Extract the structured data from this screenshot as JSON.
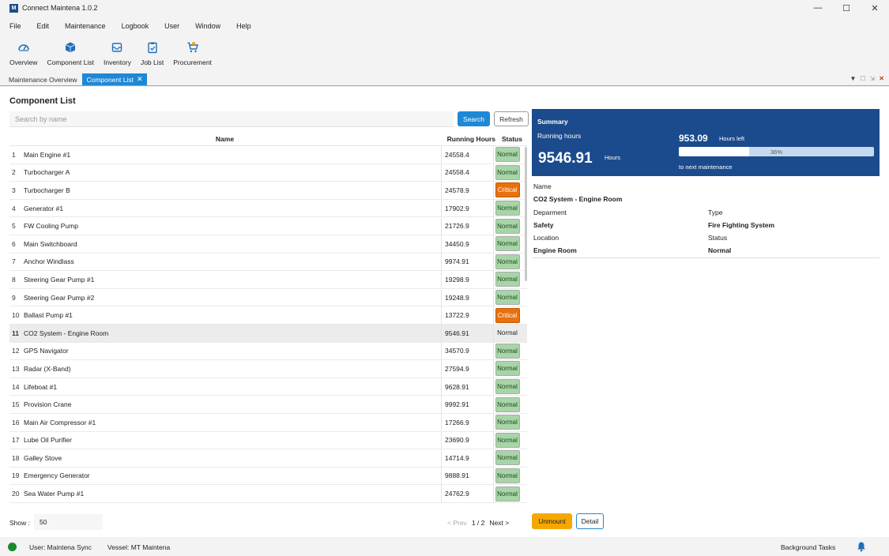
{
  "window": {
    "title": "Connect Maintena 1.0.2",
    "logo_letter": "M",
    "minimize": "—",
    "maximize": "☐",
    "close": "✕"
  },
  "menu": [
    "File",
    "Edit",
    "Maintenance",
    "Logbook",
    "User",
    "Window",
    "Help"
  ],
  "toolbar": [
    {
      "label": "Overview",
      "icon": "gauge-icon"
    },
    {
      "label": "Component List",
      "icon": "cube-icon"
    },
    {
      "label": "Inventory",
      "icon": "inbox-icon"
    },
    {
      "label": "Job List",
      "icon": "clipboard-icon"
    },
    {
      "label": "Procurement",
      "icon": "cart-icon"
    }
  ],
  "tabs": [
    {
      "label": "Maintenance Overview",
      "active": false
    },
    {
      "label": "Component List",
      "active": true,
      "close": "✕"
    }
  ],
  "tab_tools": {
    "menu": "▼",
    "max": "☐",
    "pin": "⇲",
    "close": "✕"
  },
  "page": {
    "title": "Component List",
    "search_placeholder": "Search by name",
    "search_label": "Search",
    "refresh_label": "Refresh"
  },
  "table": {
    "headers": {
      "name": "Name",
      "hours": "Running Hours",
      "status": "Status"
    },
    "rows": [
      {
        "num": "1",
        "name": "Main Engine #1",
        "hours": "24558.4",
        "status": "Normal"
      },
      {
        "num": "2",
        "name": "Turbocharger A",
        "hours": "24558.4",
        "status": "Normal"
      },
      {
        "num": "3",
        "name": "Turbocharger B",
        "hours": "24578.9",
        "status": "Critical"
      },
      {
        "num": "4",
        "name": "Generator #1",
        "hours": "17902.9",
        "status": "Normal"
      },
      {
        "num": "5",
        "name": "FW Cooling Pump",
        "hours": "21726.9",
        "status": "Normal"
      },
      {
        "num": "6",
        "name": "Main Switchboard",
        "hours": "34450.9",
        "status": "Normal"
      },
      {
        "num": "7",
        "name": "Anchor Windlass",
        "hours": "9974.91",
        "status": "Normal"
      },
      {
        "num": "8",
        "name": "Steering Gear Pump #1",
        "hours": "19298.9",
        "status": "Normal"
      },
      {
        "num": "9",
        "name": "Steering Gear Pump #2",
        "hours": "19248.9",
        "status": "Normal"
      },
      {
        "num": "10",
        "name": "Ballast Pump #1",
        "hours": "13722.9",
        "status": "Critical"
      },
      {
        "num": "11",
        "name": "CO2 System - Engine Room",
        "hours": "9546.91",
        "status": "Normal",
        "selected": true
      },
      {
        "num": "12",
        "name": "GPS Navigator",
        "hours": "34570.9",
        "status": "Normal"
      },
      {
        "num": "13",
        "name": "Radar (X-Band)",
        "hours": "27594.9",
        "status": "Normal"
      },
      {
        "num": "14",
        "name": "Lifeboat #1",
        "hours": "9628.91",
        "status": "Normal"
      },
      {
        "num": "15",
        "name": "Provision Crane",
        "hours": "9992.91",
        "status": "Normal"
      },
      {
        "num": "16",
        "name": "Main Air Compressor #1",
        "hours": "17266.9",
        "status": "Normal"
      },
      {
        "num": "17",
        "name": "Lube Oil Purifier",
        "hours": "23690.9",
        "status": "Normal"
      },
      {
        "num": "18",
        "name": "Galley Stove",
        "hours": "14714.9",
        "status": "Normal"
      },
      {
        "num": "19",
        "name": "Emergency Generator",
        "hours": "9888.91",
        "status": "Normal"
      },
      {
        "num": "20",
        "name": "Sea Water Pump #1",
        "hours": "24762.9",
        "status": "Normal"
      }
    ]
  },
  "summary": {
    "title": "Summary",
    "running_label": "Running hours",
    "running_value": "9546.91",
    "running_unit": "Hours",
    "left_value": "953.09",
    "left_unit": "Hours left",
    "progress_text": "36%",
    "progress_fraction": 0.36,
    "next_label": "to next maintenance"
  },
  "details": {
    "name_label": "Name",
    "name_value": "CO2 System - Engine Room",
    "department_label": "Deparment",
    "department_value": "Safety",
    "type_label": "Type",
    "type_value": "Fire Fighting System",
    "location_label": "Location",
    "location_value": "Engine Room",
    "status_label": "Status",
    "status_value": "Normal"
  },
  "footer": {
    "show_label": "Show :",
    "show_value": "50",
    "prev": "< Prev",
    "page": "1 / 2",
    "next": "Next >",
    "unmount_label": "Unmount",
    "detail_label": "Detail"
  },
  "statusbar": {
    "user": "User: Maintena Sync",
    "vessel": "Vessel: MT Maintena",
    "background_tasks": "Background Tasks"
  },
  "colors": {
    "primary": "#1f88d6",
    "summary_bg": "#1b4b8c",
    "normal": "#a8d5a8",
    "critical": "#e8710e",
    "unmount": "#f6a800",
    "online": "#1b8a2a"
  }
}
